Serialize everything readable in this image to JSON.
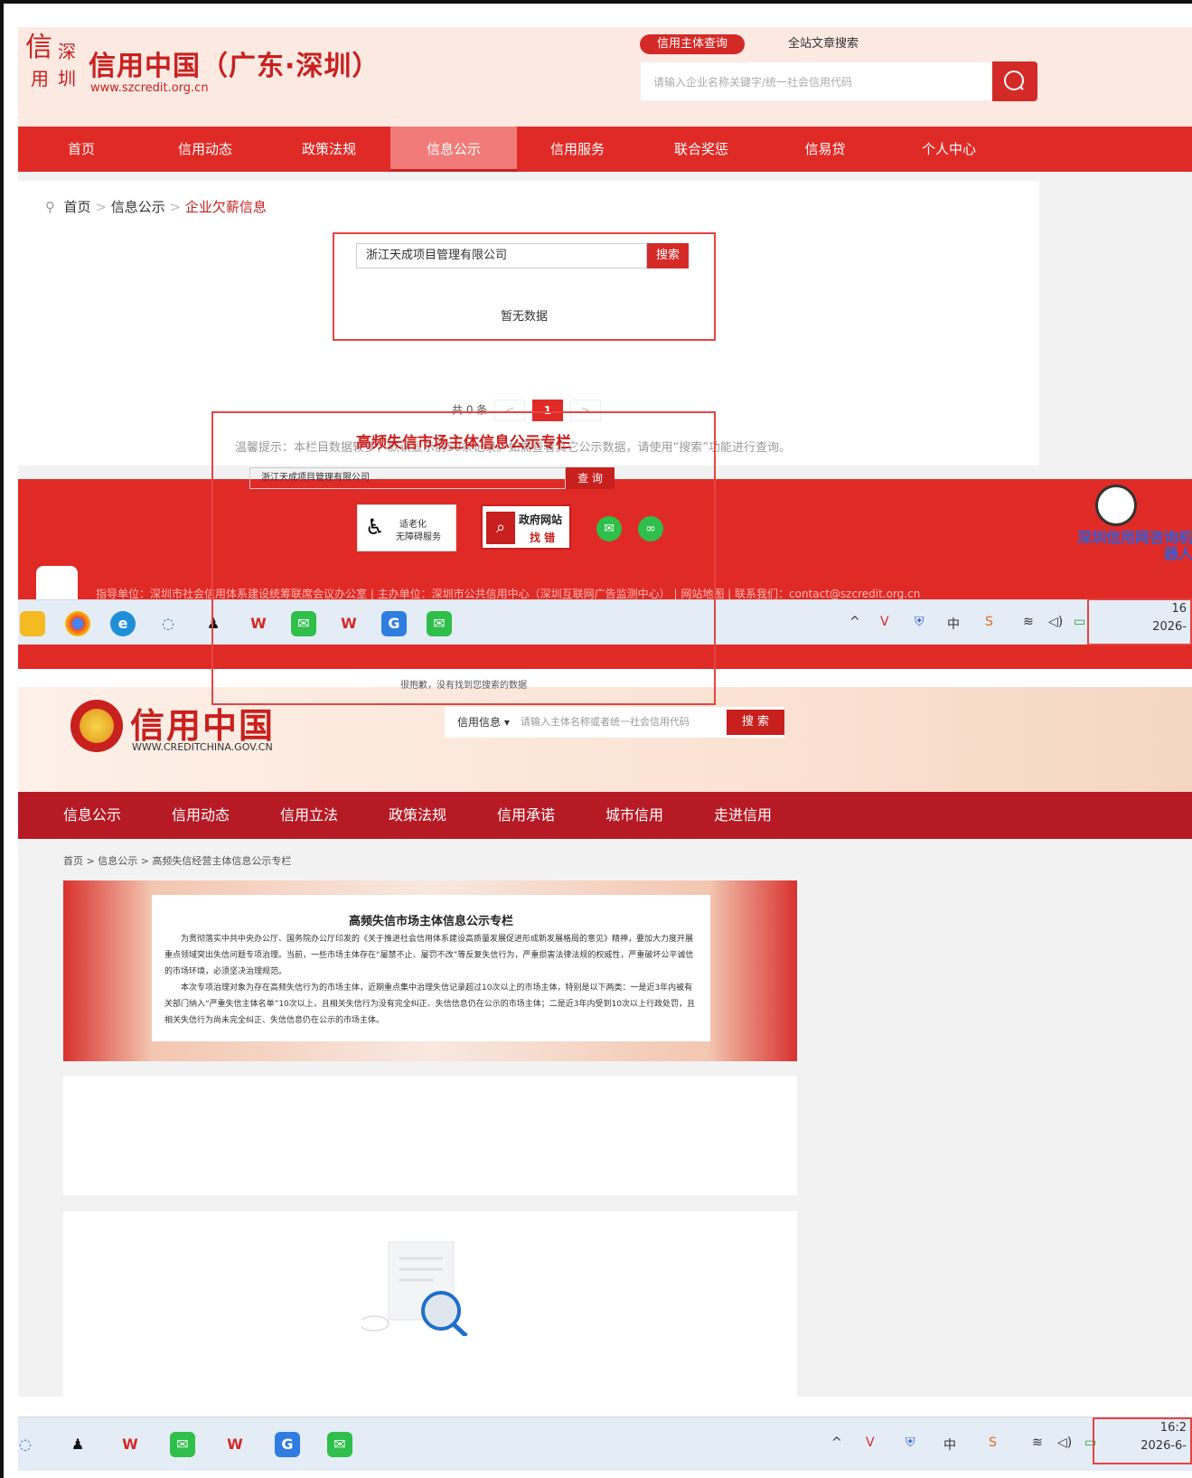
{
  "top": {
    "logo_chars": [
      "信",
      "深",
      "用",
      "圳"
    ],
    "site_title": "信用中国（广东·深圳）",
    "site_url": "www.szcredit.org.cn",
    "tab_active": "信用主体查询",
    "tab_other": "全站文章搜索",
    "search_placeholder": "请输入企业名称关键字/统一社会信用代码",
    "nav": [
      "首页",
      "信用动态",
      "政策法规",
      "信息公示",
      "信用服务",
      "联合奖惩",
      "信易贷",
      "个人中心"
    ],
    "breadcrumb": {
      "home": "首页",
      "sep": ">",
      "level2": "信息公示",
      "current": "企业欠薪信息"
    },
    "query_value": "浙江天成项目管理有限公司",
    "query_button": "搜索",
    "no_data": "暂无数据",
    "pager": {
      "total": "共 0 条",
      "prev": "<",
      "page": "1",
      "next": ">"
    },
    "tip": "温馨提示：本栏目数据较多，默认显示前50条记录。如需查看其它公示数据，请使用“搜索”功能进行查询。",
    "footer": {
      "elderly_1": "适老化",
      "elderly_2": "无障碍服务",
      "gov_1": "政府网站",
      "gov_2": "找 错",
      "info": "指导单位：深圳市社会信用体系建设统筹联席会议办公室 | 主办单位：深圳市公共信用中心（深圳互联网广告监测中心） | 网站地图 | 联系我们：contact@szcredit.org.cn",
      "robot": "深圳信用网咨询机器人"
    }
  },
  "taskbar1": {
    "clock_time": "16",
    "clock_date": "2026-",
    "ime": "中"
  },
  "bottom": {
    "site_title": "信用中国",
    "site_url": "WWW.CREDITCHINA.GOV.CN",
    "search_select": "信用信息 ▾",
    "search_placeholder": "请输入主体名称或者统一社会信用代码",
    "search_button": "搜 索",
    "nav": [
      "信息公示",
      "信用动态",
      "信用立法",
      "政策法规",
      "信用承诺",
      "城市信用",
      "走进信用"
    ],
    "breadcrumb": "首页 > 信息公示 > 高频失信经营主体信息公示专栏",
    "banner_title": "高频失信市场主体信息公示专栏",
    "banner_p1": "为贯彻落实中共中央办公厅、国务院办公厅印发的《关于推进社会信用体系建设高质量发展促进形成新发展格局的意见》精神，要加大力度开展重点领域突出失信问题专项治理。当前，一些市场主体存在“屡禁不止、屡罚不改”等反复失信行为，严重损害法律法规的权威性，严重破坏公平诚信的市场环境，必须坚决治理规范。",
    "banner_p2": "本次专项治理对象为存在高频失信行为的市场主体，近期重点集中治理失信记录超过10次以上的市场主体，特别是以下两类：一是近3年内被有关部门纳入“严重失信主体名单”10次以上，且相关失信行为没有完全纠正、失信信息仍在公示的市场主体；二是近3年内受到10次以上行政处罚，且相关失信行为尚未完全纠正、失信信息仍在公示的市场主体。",
    "box_title": "高频失信市场主体信息公示专栏",
    "query_value": "浙江天成项目管理有限公司",
    "query_button": "查 询",
    "no_data": "很抱歉，没有找到您搜索的数据"
  },
  "taskbar2": {
    "clock_time": "16:2",
    "clock_date": "2026-6-",
    "ime": "中"
  },
  "colors": {
    "brand_red": "#e02a26",
    "dark_red": "#b51a25",
    "highlight_box": "#e64442"
  }
}
